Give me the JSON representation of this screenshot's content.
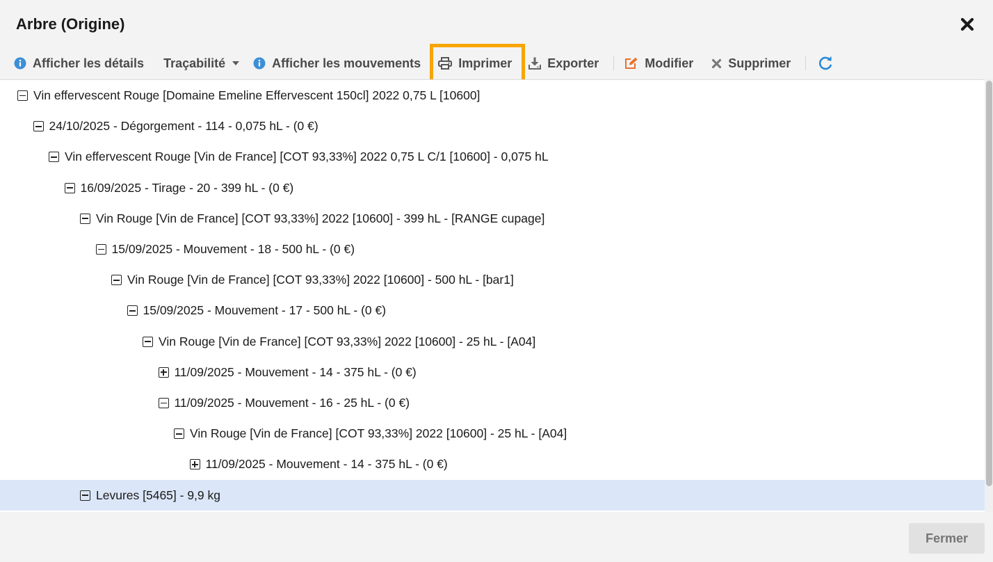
{
  "dialog": {
    "title": "Arbre (Origine)"
  },
  "toolbar": {
    "details_label": "Afficher les détails",
    "traceability_label": "Traçabilité",
    "movements_label": "Afficher les mouvements",
    "print_label": "Imprimer",
    "export_label": "Exporter",
    "edit_label": "Modifier",
    "delete_label": "Supprimer"
  },
  "colors": {
    "info_icon": "#3d8fd6",
    "edit_icon": "#e8722c",
    "refresh_icon": "#2a88d6",
    "highlight_border": "#f7a500",
    "selected_row": "#dbe7f8"
  },
  "tree": {
    "nodes": [
      {
        "text": "Vin effervescent Rouge [Domaine Emeline Effervescent 150cl] 2022 0,75 L [10600]",
        "expanded": true,
        "level": 0
      },
      {
        "text": "24/10/2025 - Dégorgement - 114 - 0,075 hL - (0 €)",
        "expanded": true,
        "level": 1
      },
      {
        "text": "Vin effervescent Rouge [Vin de France] [COT 93,33%] 2022 0,75 L C/1 [10600] - 0,075 hL",
        "expanded": true,
        "level": 2
      },
      {
        "text": "16/09/2025 - Tirage - 20 - 399 hL - (0 €)",
        "expanded": true,
        "level": 3
      },
      {
        "text": "Vin Rouge [Vin de France] [COT 93,33%] 2022 [10600] - 399 hL - [RANGE cupage]",
        "expanded": true,
        "level": 4
      },
      {
        "text": "15/09/2025 - Mouvement - 18 - 500 hL - (0 €)",
        "expanded": true,
        "level": 5
      },
      {
        "text": "Vin Rouge [Vin de France] [COT 93,33%] 2022 [10600] - 500 hL - [bar1]",
        "expanded": true,
        "level": 6
      },
      {
        "text": "15/09/2025 - Mouvement - 17 - 500 hL - (0 €)",
        "expanded": true,
        "level": 7
      },
      {
        "text": "Vin Rouge [Vin de France] [COT 93,33%] 2022 [10600] - 25 hL - [A04]",
        "expanded": true,
        "level": 8
      },
      {
        "text": "11/09/2025 - Mouvement - 14 - 375 hL - (0 €)",
        "expanded": false,
        "level": 9
      },
      {
        "text": "11/09/2025 - Mouvement - 16 - 25 hL - (0 €)",
        "expanded": true,
        "level": 9
      },
      {
        "text": "Vin Rouge [Vin de France] [COT 93,33%] 2022 [10600] - 25 hL - [A04]",
        "expanded": true,
        "level": 10
      },
      {
        "text": "11/09/2025 - Mouvement - 14 - 375 hL - (0 €)",
        "expanded": false,
        "level": 11
      },
      {
        "text": "Levures [5465] - 9,9 kg",
        "expanded": true,
        "level": 4,
        "selected": true
      }
    ]
  },
  "footer": {
    "close_label": "Fermer"
  }
}
